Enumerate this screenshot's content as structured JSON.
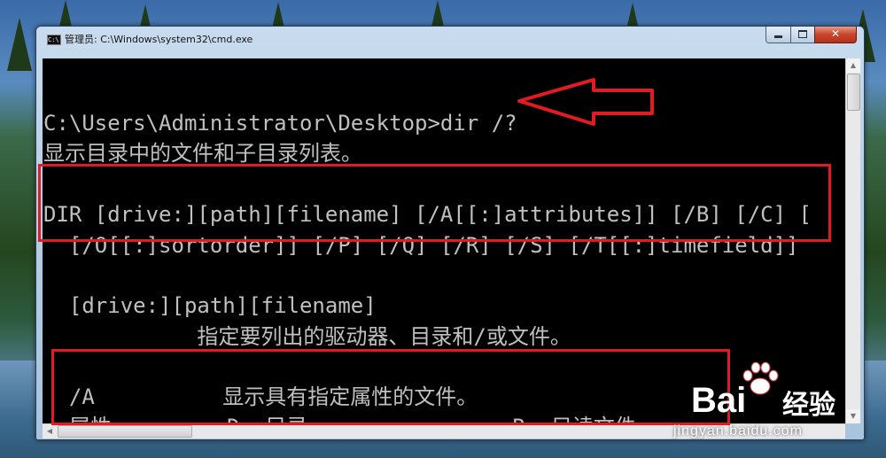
{
  "window": {
    "title": "管理员: C:\\Windows\\system32\\cmd.exe",
    "icon": "cmd-icon",
    "icon_text": "C:\\"
  },
  "console": {
    "lines": [
      "C:\\Users\\Administrator\\Desktop>dir /?",
      "显示目录中的文件和子目录列表。",
      "DIR [drive:][path][filename] [/A[[:]attributes]] [/B] [/C] [",
      "  [/O[[:]sortorder]] [/P] [/Q] [/R] [/S] [/T[[:]timefield]]",
      "  [drive:][path][filename]",
      "            指定要列出的驱动器、目录和/或文件。",
      "  /A          显示具有指定属性的文件。",
      "  属性         D  目录                R  只读文件"
    ]
  },
  "annotations": {
    "arrow_color": "#e21a22",
    "box_color": "#e21a22"
  },
  "watermark": {
    "brand": "Bai",
    "brand_suffix": "经验",
    "url": "jingyan.baidu.com"
  }
}
